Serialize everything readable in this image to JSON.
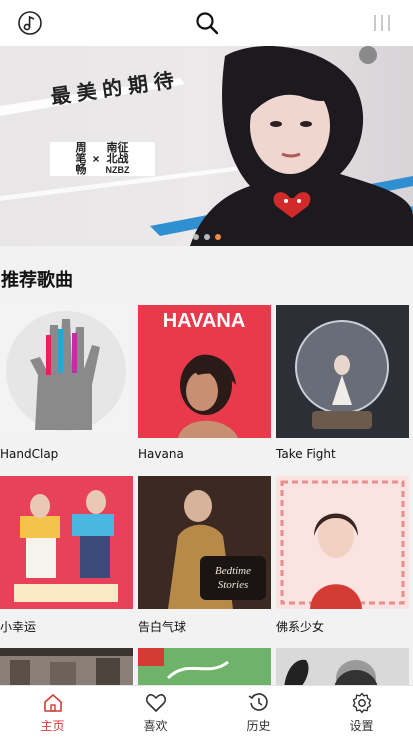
{
  "header": {
    "music_icon": "music-note-circle-icon",
    "search_icon": "search-icon",
    "menu_icon": "menu-bars-icon"
  },
  "banner": {
    "headline": "最美的期待",
    "artist_a": [
      "周",
      "笔",
      "畅"
    ],
    "x_mark": "×",
    "artist_b": [
      "南征",
      "北战",
      "NZBZ"
    ],
    "dots": 3,
    "active_dot": 2,
    "active_dot_color": "#f08a4b"
  },
  "section": {
    "title": "推荐歌曲"
  },
  "songs": [
    {
      "title": "HandClap"
    },
    {
      "title": "Havana"
    },
    {
      "title": "Take Fight"
    },
    {
      "title": "小幸运"
    },
    {
      "title": "告白气球"
    },
    {
      "title": "佛系少女"
    },
    {
      "title": ""
    },
    {
      "title": ""
    },
    {
      "title": ""
    }
  ],
  "tabs": [
    {
      "label": "主页",
      "icon": "home-icon",
      "active": true
    },
    {
      "label": "喜欢",
      "icon": "heart-icon",
      "active": false
    },
    {
      "label": "历史",
      "icon": "history-icon",
      "active": false
    },
    {
      "label": "设置",
      "icon": "gear-icon",
      "active": false
    }
  ],
  "colors": {
    "accent": "#d43c33"
  }
}
